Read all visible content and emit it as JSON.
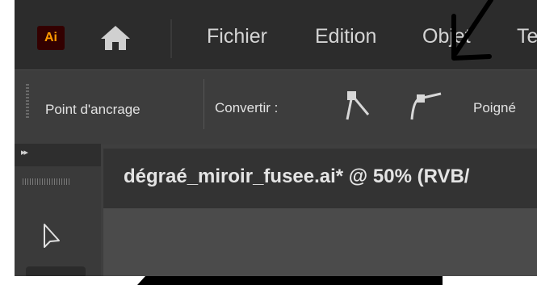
{
  "app": {
    "logo": "Ai",
    "logo_color": "#ff9a00",
    "logo_bg": "#330000"
  },
  "menu": {
    "items": [
      "Fichier",
      "Edition",
      "Objet",
      "Te"
    ]
  },
  "controlbar": {
    "anchor_label": "Point d'ancrage",
    "convert_label": "Convertir :",
    "handles_label": "Poigné"
  },
  "document": {
    "tab_title": "dégraé_miroir_fusee.ai* @ 50% (RVB/"
  },
  "icons": {
    "home": "home-icon",
    "anchor_corner": "anchor-corner-icon",
    "anchor_smooth": "anchor-smooth-icon",
    "selection": "selection-arrow-icon",
    "collapse": "collapse-panels-icon"
  }
}
